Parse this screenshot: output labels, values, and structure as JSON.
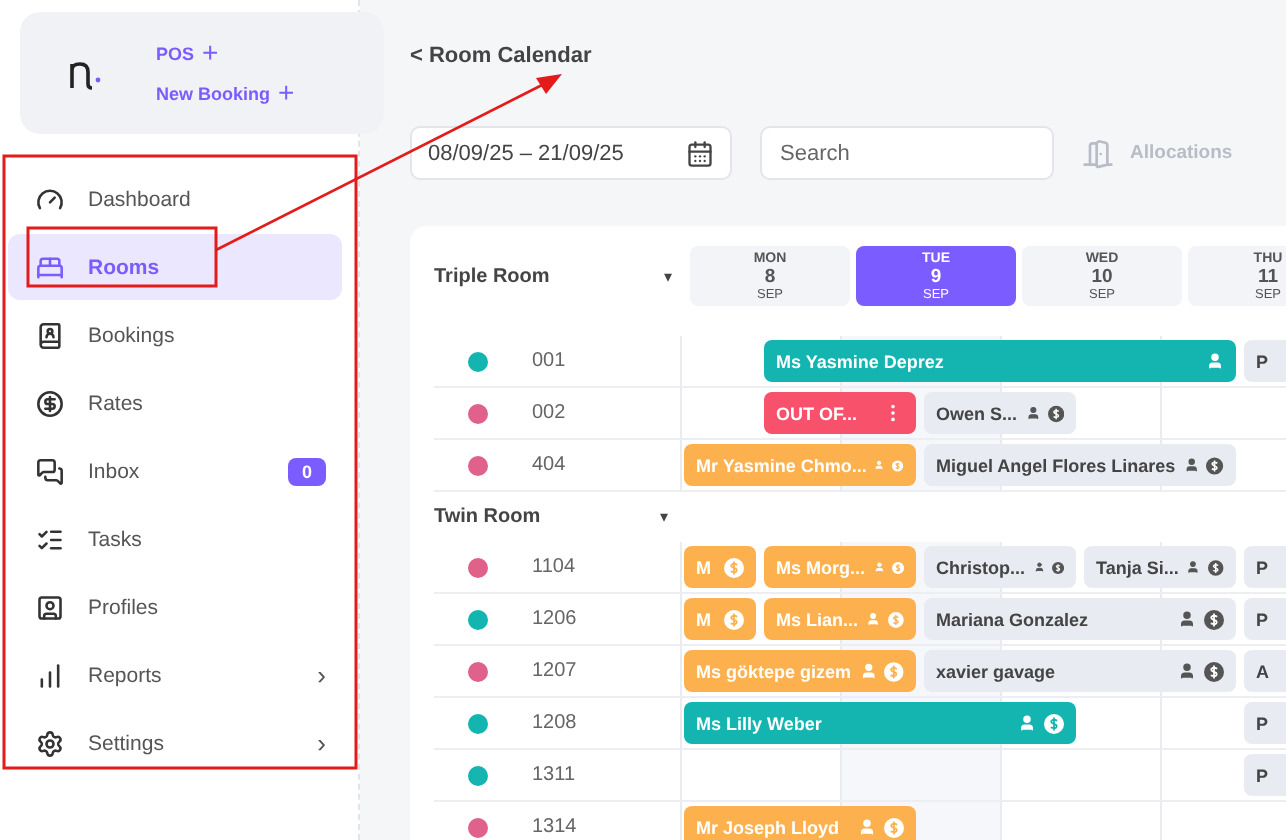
{
  "brand": {
    "actions": [
      {
        "label": "POS",
        "icon": "+"
      },
      {
        "label": "New Booking",
        "icon": "+"
      }
    ]
  },
  "nav": [
    {
      "label": "Dashboard",
      "selected": false
    },
    {
      "label": "Rooms",
      "selected": true
    },
    {
      "label": "Bookings",
      "selected": false
    },
    {
      "label": "Rates",
      "selected": false
    },
    {
      "label": "Inbox",
      "selected": false,
      "badge": "0"
    },
    {
      "label": "Tasks",
      "selected": false
    },
    {
      "label": "Profiles",
      "selected": false
    },
    {
      "label": "Reports",
      "selected": false,
      "chevron": "›"
    },
    {
      "label": "Settings",
      "selected": false,
      "chevron": "›"
    }
  ],
  "page_title": "< Room Calendar",
  "toolbar": {
    "date_range": "08/09/25 – 21/09/25",
    "search": {
      "placeholder": "Search"
    },
    "allocations": "Allocations"
  },
  "days": [
    {
      "weekday": "MON",
      "day": "8",
      "month": "SEP",
      "selected": false
    },
    {
      "weekday": "TUE",
      "day": "9",
      "month": "SEP",
      "selected": true
    },
    {
      "weekday": "WED",
      "day": "10",
      "month": "SEP",
      "selected": false
    },
    {
      "weekday": "THU",
      "day": "11",
      "month": "SEP",
      "selected": false
    }
  ],
  "groups": [
    {
      "name": "Triple Room",
      "caret": "▾",
      "rooms": [
        {
          "number": "001",
          "color": "#14b5b0",
          "bookings": [
            {
              "name": "Ms Yasmine Deprez",
              "color": "#14b5b0",
              "guest": true,
              "payment": false,
              "menu": false
            },
            {
              "name": "P",
              "color": "#e9ebf3",
              "guest": false,
              "payment": false,
              "menu": false
            }
          ]
        },
        {
          "number": "002",
          "color": "#e0618a",
          "bookings": [
            {
              "name": "OUT OF...",
              "color": "#f7516c",
              "guest": false,
              "payment": false,
              "menu": true
            },
            {
              "name": "Owen S...",
              "color": "#e9ebf3",
              "guest": true,
              "payment": true,
              "menu": false
            }
          ]
        },
        {
          "number": "404",
          "color": "#e0618a",
          "bookings": [
            {
              "name": "Mr Yasmine Chmo...",
              "color": "#fdb14e",
              "guest": true,
              "payment": true,
              "menu": false
            },
            {
              "name": "Miguel Angel Flores Linares",
              "color": "#e9ebf3",
              "guest": true,
              "payment": true,
              "menu": false
            }
          ]
        }
      ]
    },
    {
      "name": "Twin Room",
      "caret": "▾",
      "rooms": [
        {
          "number": "1104",
          "color": "#e0618a",
          "bookings": [
            {
              "name": "M",
              "color": "#fdb14e",
              "guest": false,
              "payment": true,
              "menu": false
            },
            {
              "name": "Ms Morg...",
              "color": "#fdb14e",
              "guest": true,
              "payment": true,
              "menu": false
            },
            {
              "name": "Christop...",
              "color": "#e9ebf3",
              "guest": true,
              "payment": true,
              "menu": false
            },
            {
              "name": "Tanja Si...",
              "color": "#e9ebf3",
              "guest": true,
              "payment": true,
              "menu": false
            },
            {
              "name": "P",
              "color": "#e9ebf3",
              "guest": false,
              "payment": false,
              "menu": false
            }
          ]
        },
        {
          "number": "1206",
          "color": "#14b5b0",
          "bookings": [
            {
              "name": "M",
              "color": "#fdb14e",
              "guest": false,
              "payment": true,
              "menu": false
            },
            {
              "name": "Ms Lian...",
              "color": "#fdb14e",
              "guest": true,
              "payment": true,
              "menu": false
            },
            {
              "name": "Mariana Gonzalez",
              "color": "#e9ebf3",
              "guest": true,
              "payment": true,
              "menu": false
            },
            {
              "name": "P",
              "color": "#e9ebf3",
              "guest": false,
              "payment": false,
              "menu": false
            }
          ]
        },
        {
          "number": "1207",
          "color": "#e0618a",
          "bookings": [
            {
              "name": "Ms göktepe gizem",
              "color": "#fdb14e",
              "guest": true,
              "payment": true,
              "menu": false
            },
            {
              "name": "xavier gavage",
              "color": "#e9ebf3",
              "guest": true,
              "payment": true,
              "menu": false
            },
            {
              "name": "A",
              "color": "#e9ebf3",
              "guest": false,
              "payment": false,
              "menu": false
            }
          ]
        },
        {
          "number": "1208",
          "color": "#14b5b0",
          "bookings": [
            {
              "name": "Ms Lilly Weber",
              "color": "#14b5b0",
              "guest": true,
              "payment": true,
              "menu": false
            },
            {
              "name": "P",
              "color": "#e9ebf3",
              "guest": false,
              "payment": false,
              "menu": false
            }
          ]
        },
        {
          "number": "1311",
          "color": "#14b5b0",
          "bookings": [
            {
              "name": "P",
              "color": "#e9ebf3",
              "guest": false,
              "payment": false,
              "menu": false
            }
          ]
        },
        {
          "number": "1314",
          "color": "#e0618a",
          "bookings": [
            {
              "name": "Mr Joseph Lloyd",
              "color": "#fdb14e",
              "guest": true,
              "payment": true,
              "menu": false
            }
          ]
        }
      ]
    }
  ]
}
